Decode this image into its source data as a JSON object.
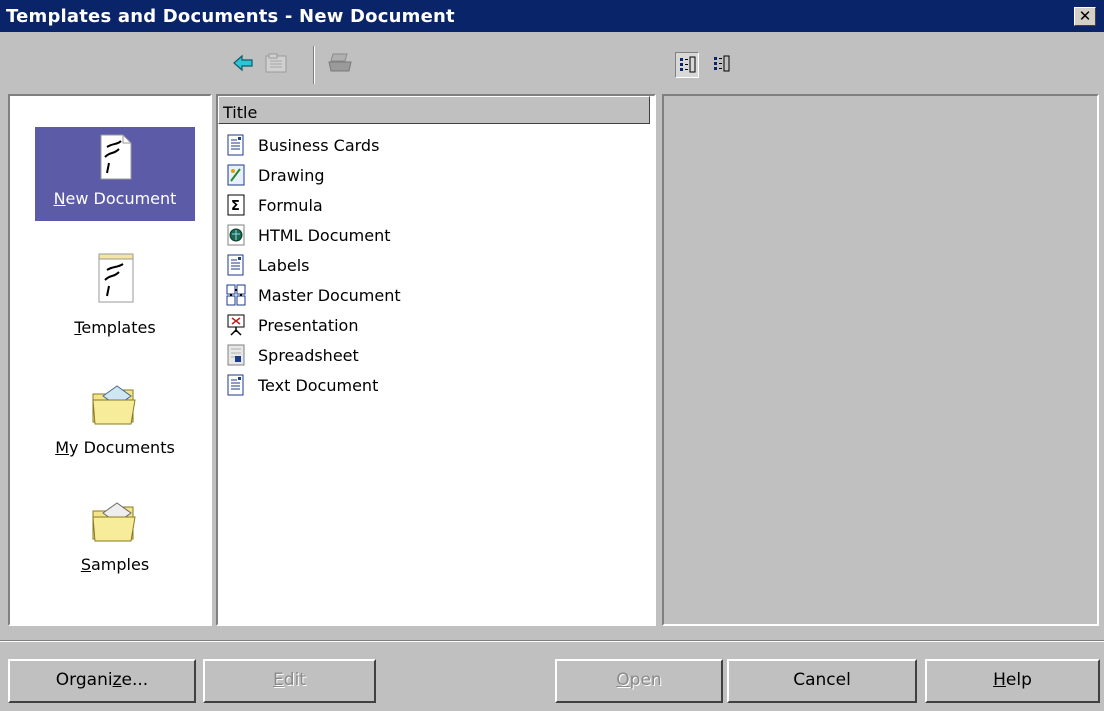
{
  "window": {
    "title": "Templates and Documents - New Document",
    "close_glyph": "✕"
  },
  "toolbar": {
    "back_icon": "back-arrow-icon",
    "up_icon": "folder-up-icon",
    "print_icon": "print-icon",
    "view_list_icon": "list-view-icon",
    "view_details_icon": "details-view-icon"
  },
  "categories": [
    {
      "label_pre": "",
      "label_key": "N",
      "label_post": "ew Document",
      "selected": true
    },
    {
      "label_pre": "",
      "label_key": "T",
      "label_post": "emplates",
      "selected": false
    },
    {
      "label_pre": "",
      "label_key": "M",
      "label_post": "y Documents",
      "selected": false
    },
    {
      "label_pre": "",
      "label_key": "S",
      "label_post": "amples",
      "selected": false
    }
  ],
  "list": {
    "column_title": "Title",
    "items": [
      {
        "label": "Business Cards",
        "icon": "text-document-icon"
      },
      {
        "label": "Drawing",
        "icon": "drawing-icon"
      },
      {
        "label": "Formula",
        "icon": "formula-icon"
      },
      {
        "label": "HTML Document",
        "icon": "html-document-icon"
      },
      {
        "label": "Labels",
        "icon": "text-document-icon"
      },
      {
        "label": "Master Document",
        "icon": "master-document-icon"
      },
      {
        "label": "Presentation",
        "icon": "presentation-icon"
      },
      {
        "label": "Spreadsheet",
        "icon": "spreadsheet-icon"
      },
      {
        "label": "Text Document",
        "icon": "text-document-icon"
      }
    ]
  },
  "buttons": {
    "organize": {
      "pre": "Organi",
      "key": "z",
      "post": "e..."
    },
    "edit": {
      "pre": "",
      "key": "E",
      "post": "dit"
    },
    "open": {
      "pre": "",
      "key": "O",
      "post": "pen"
    },
    "cancel": "Cancel",
    "help": {
      "pre": "",
      "key": "H",
      "post": "elp"
    }
  },
  "colors": {
    "titlebar": "#0a246a",
    "selection": "#5b5ba8",
    "face": "#c0c0c0"
  }
}
